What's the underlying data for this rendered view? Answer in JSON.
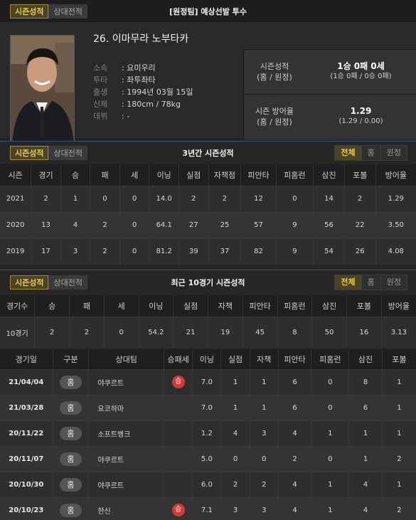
{
  "header": {
    "tabs": [
      "시즌성적",
      "상대전적"
    ],
    "title": "[원정팀] 예상선발 투수"
  },
  "profile": {
    "name": "26. 이마무라 노부타카",
    "fields": [
      {
        "label": "소속",
        "value": ": 요미우리"
      },
      {
        "label": "투타",
        "value": ": 좌투좌타"
      },
      {
        "label": "출생",
        "value": ": 1994년 03월 15일"
      },
      {
        "label": "신체",
        "value": ": 180cm / 78kg"
      },
      {
        "label": "데뷔",
        "value": ": -"
      }
    ],
    "season_record": {
      "label1": "시즌성적",
      "label2": "(홈 / 원정)",
      "main": "1승 0패 0세",
      "sub": "(1승 0패 / 0승 0패)"
    },
    "season_era": {
      "label1": "시즌 방어율",
      "label2": "(홈 / 원정)",
      "main": "1.29",
      "sub": "(1.29 / 0.00)"
    }
  },
  "season3": {
    "tabs": [
      "시즌성적",
      "상대전적"
    ],
    "title": "3년간 시즌성적",
    "filters": [
      "전체",
      "홈",
      "원정"
    ],
    "columns": [
      "시즌",
      "경기",
      "승",
      "패",
      "세",
      "이닝",
      "실점",
      "자책점",
      "피안타",
      "피홈런",
      "삼진",
      "포볼",
      "방어율"
    ],
    "rows": [
      [
        "2021",
        "2",
        "1",
        "0",
        "0",
        "14.0",
        "2",
        "2",
        "12",
        "0",
        "14",
        "2",
        "1.29"
      ],
      [
        "2020",
        "13",
        "4",
        "2",
        "0",
        "64.1",
        "27",
        "25",
        "57",
        "9",
        "56",
        "22",
        "3.50"
      ],
      [
        "2019",
        "17",
        "3",
        "2",
        "0",
        "81.2",
        "39",
        "37",
        "82",
        "9",
        "54",
        "26",
        "4.08"
      ]
    ]
  },
  "recent10": {
    "tabs": [
      "시즌성적",
      "상대전적"
    ],
    "title": "최근 10경기 시즌성적",
    "filters": [
      "전체",
      "홈",
      "원정"
    ],
    "columns": [
      "경기수",
      "승",
      "패",
      "세",
      "이닝",
      "실점",
      "자책",
      "피안타",
      "피홈런",
      "삼진",
      "포볼",
      "방어율"
    ],
    "summary": [
      "10경기",
      "2",
      "2",
      "0",
      "54.2",
      "21",
      "19",
      "45",
      "8",
      "50",
      "16",
      "3.13"
    ]
  },
  "games": {
    "columns": [
      "경기일",
      "구분",
      "상대팀",
      "승패세",
      "이닝",
      "실점",
      "자책",
      "피안타",
      "피홈런",
      "삼진",
      "포볼"
    ],
    "rows": [
      {
        "date": "21/04/04",
        "type": "홈",
        "opp": "야쿠르트",
        "result": "승",
        "ip": "7.0",
        "r": "1",
        "er": "1",
        "h": "6",
        "hr": "0",
        "so": "8",
        "bb": "1"
      },
      {
        "date": "21/03/28",
        "type": "홈",
        "opp": "요코하마",
        "result": "",
        "ip": "7.0",
        "r": "1",
        "er": "1",
        "h": "6",
        "hr": "0",
        "so": "6",
        "bb": "1"
      },
      {
        "date": "20/11/22",
        "type": "홈",
        "opp": "소프트뱅크",
        "result": "",
        "ip": "1.2",
        "r": "4",
        "er": "3",
        "h": "4",
        "hr": "1",
        "so": "1",
        "bb": "1"
      },
      {
        "date": "20/11/07",
        "type": "홈",
        "opp": "야쿠르트",
        "result": "",
        "ip": "5.0",
        "r": "0",
        "er": "0",
        "h": "2",
        "hr": "0",
        "so": "1",
        "bb": "2"
      },
      {
        "date": "20/10/30",
        "type": "홈",
        "opp": "야쿠르트",
        "result": "",
        "ip": "6.0",
        "r": "2",
        "er": "2",
        "h": "4",
        "hr": "1",
        "so": "4",
        "bb": "1"
      },
      {
        "date": "20/10/23",
        "type": "홈",
        "opp": "한신",
        "result": "승",
        "ip": "7.1",
        "r": "3",
        "er": "3",
        "h": "4",
        "hr": "1",
        "so": "4",
        "bb": "2"
      }
    ]
  },
  "colors": {
    "accent": "#f1cc3e",
    "win_badge": "#d13a3a",
    "divider": "#3a4f7a"
  }
}
